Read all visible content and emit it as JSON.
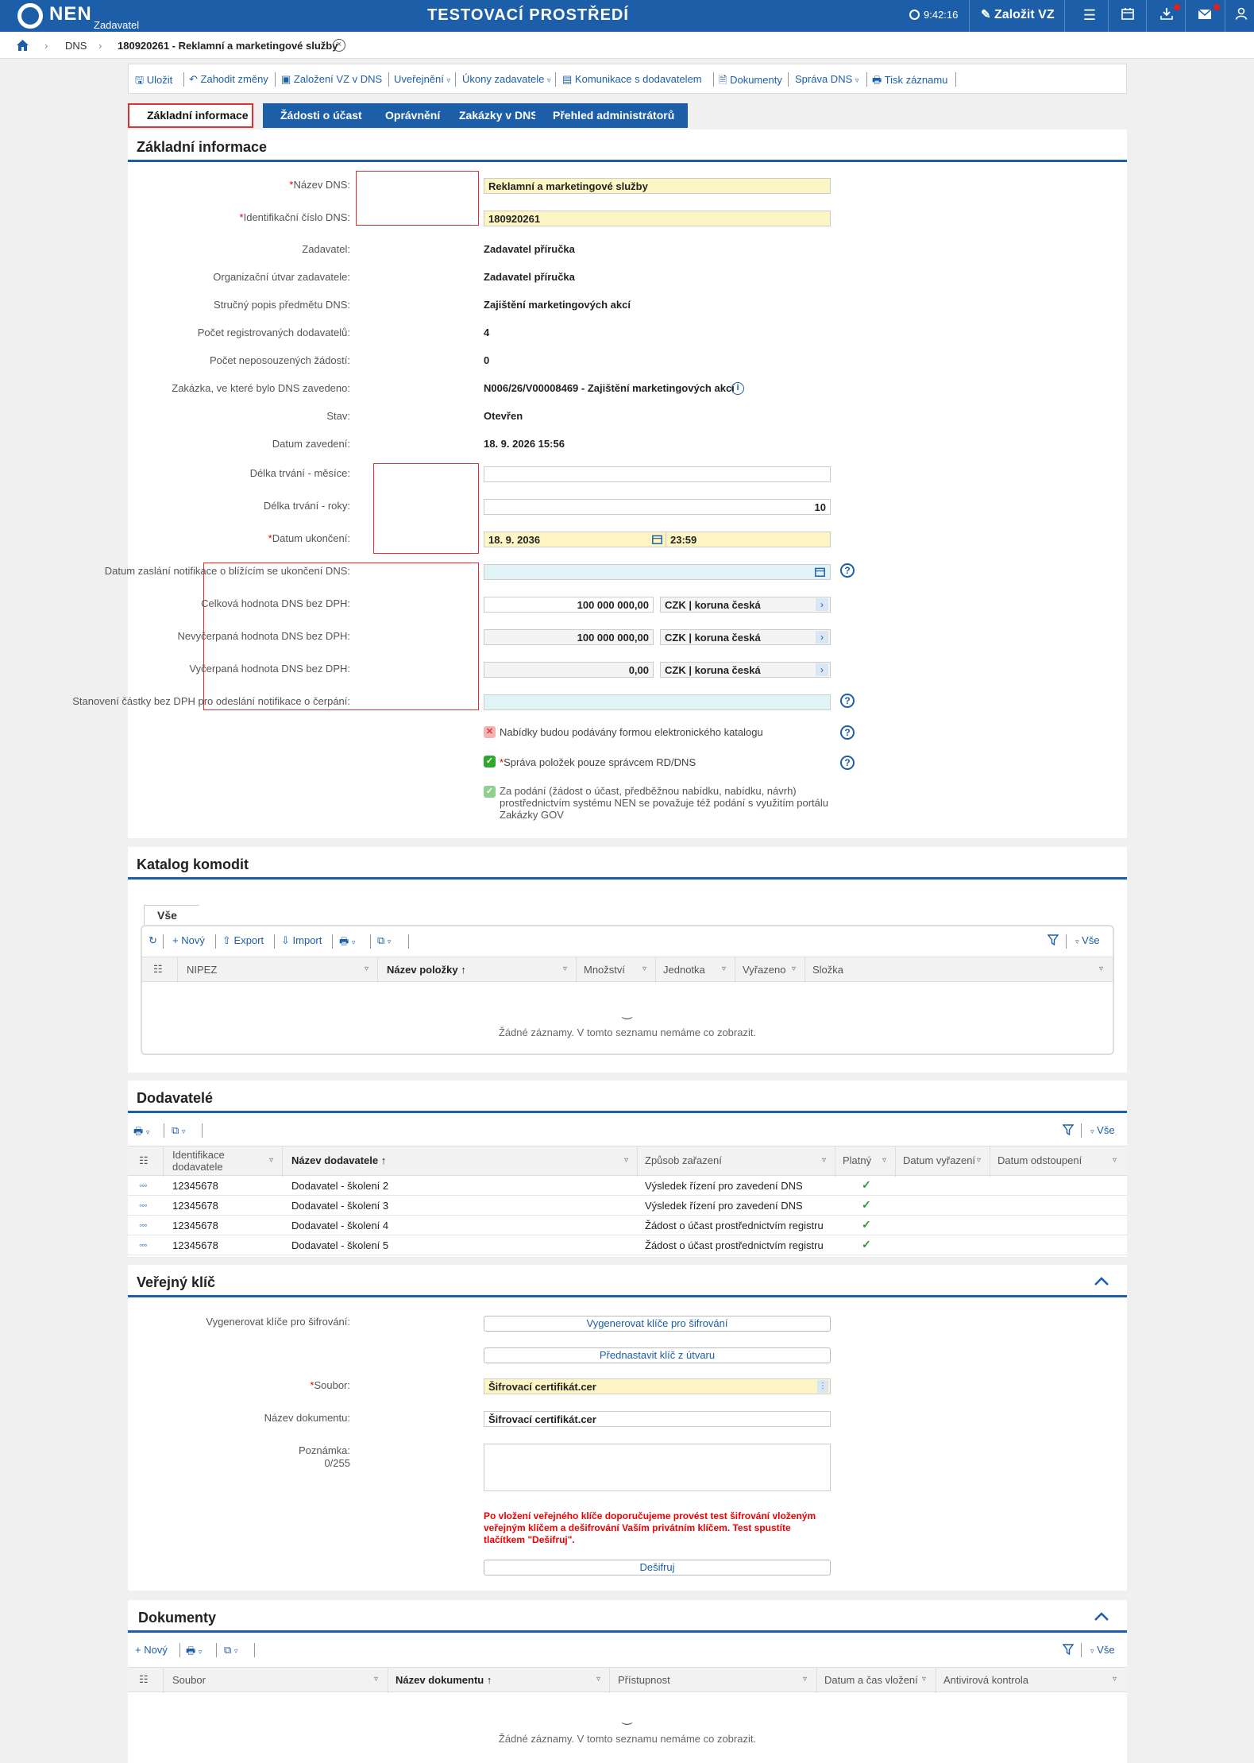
{
  "topbar": {
    "logo": "NEN",
    "logo_sub": "Zadavatel",
    "env_title": "TESTOVACÍ PROSTŘEDÍ",
    "time": "9:42:16",
    "create_label": "Založit VZ"
  },
  "breadcrumb": {
    "item1": "DNS",
    "item2": "180920261 - Reklamní a marketingové služby"
  },
  "toolbar": {
    "save": "Uložit",
    "discard": "Zahodit změny",
    "create_vz": "Založení VZ v DNS",
    "publish": "Uveřejnění",
    "acts": "Úkony zadavatele",
    "comm": "Komunikace s dodavatelem",
    "docs": "Dokumenty",
    "manage": "Správa DNS",
    "print": "Tisk záznamu"
  },
  "tabs": [
    "Základní informace",
    "Žádosti o účast",
    "Oprávnění",
    "Zakázky v DNS",
    "Přehled administrátorů"
  ],
  "basic": {
    "title": "Základní informace",
    "name_label": "Název DNS:",
    "name_value": "Reklamní a marketingové služby",
    "id_label": "Identifikační číslo DNS:",
    "id_value": "180920261",
    "buyer_label": "Zadavatel:",
    "buyer_value": "Zadavatel příručka",
    "org_label": "Organizační útvar zadavatele:",
    "org_value": "Zadavatel příručka",
    "desc_label": "Stručný popis předmětu DNS:",
    "desc_value": "Zajištění marketingových akcí",
    "reg_label": "Počet registrovaných dodavatelů:",
    "reg_value": "4",
    "pending_label": "Počet neposouzených žádostí:",
    "pending_value": "0",
    "tender_label": "Zakázka, ve které bylo DNS zavedeno:",
    "tender_value": "N006/26/V00008469 - Zajištění marketingových akcí",
    "state_label": "Stav:",
    "state_value": "Otevřen",
    "date_label": "Datum zavedení:",
    "date_value": "18. 9. 2026 15:56",
    "months_label": "Délka trvání - měsíce:",
    "months_value": "",
    "years_label": "Délka trvání - roky:",
    "years_value": "10",
    "end_label": "Datum ukončení:",
    "end_date": "18. 9. 2036",
    "end_time": "23:59",
    "notify_label": "Datum zaslání notifikace o blížícím se ukončení DNS:",
    "total_label": "Celková hodnota DNS bez DPH:",
    "total_value": "100 000 000,00",
    "remaining_label": "Nevyčerpaná hodnota DNS bez DPH:",
    "remaining_value": "100 000 000,00",
    "used_label": "Vyčerpaná hodnota DNS bez DPH:",
    "used_value": "0,00",
    "currency": "CZK | koruna česká",
    "amount_label": "Stanovení částky bez DPH pro odeslání notifikace o čerpání:",
    "cb1": "Nabídky budou podávány formou elektronického katalogu",
    "cb2": "Správa položek pouze správcem RD/DNS",
    "cb3": "Za podání (žádost o účast, předběžnou nabídku, nabídku, návrh) prostřednictvím systému NEN se považuje též podání s využitím portálu Zakázky GOV"
  },
  "catalog": {
    "title": "Katalog komodit",
    "subtab": "Vše",
    "new": "Nový",
    "export": "Export",
    "import": "Import",
    "all": "Vše",
    "columns": [
      "NIPEZ",
      "Název položky",
      "Množství",
      "Jednotka",
      "Vyřazeno",
      "Složka"
    ],
    "empty": "Žádné záznamy. V tomto seznamu nemáme co zobrazit."
  },
  "suppliers": {
    "title": "Dodavatelé",
    "all": "Vše",
    "col_id": "Identifikace dodavatele",
    "col_name": "Název dodavatele",
    "col_way": "Způsob zařazení",
    "col_valid": "Platný",
    "col_removed": "Datum vyřazení",
    "col_withdrawn": "Datum odstoupení",
    "rows": [
      {
        "id": "12345678",
        "name": "Dodavatel - školení 2",
        "way": "Výsledek řízení pro zavedení DNS"
      },
      {
        "id": "12345678",
        "name": "Dodavatel - školení 3",
        "way": "Výsledek řízení pro zavedení DNS"
      },
      {
        "id": "12345678",
        "name": "Dodavatel - školení 4",
        "way": "Žádost o účast prostřednictvím registru"
      },
      {
        "id": "12345678",
        "name": "Dodavatel - školení 5",
        "way": "Žádost o účast prostřednictvím registru"
      }
    ]
  },
  "pubkey": {
    "title": "Veřejný klíč",
    "gen_label": "Vygenerovat klíče pro šifrování:",
    "gen_btn": "Vygenerovat klíče pro šifrování",
    "preset_btn": "Přednastavit klíč z útvaru",
    "file_label": "Soubor:",
    "file_value": "Šifrovací certifikát.cer",
    "docname_label": "Název dokumentu:",
    "docname_value": "Šifrovací certifikát.cer",
    "note_label": "Poznámka:",
    "note_count": "0/255",
    "warning": "Po vložení veřejného klíče doporučujeme provést test šifrování vloženým veřejným klíčem a dešifrování Vaším privátním klíčem. Test spustíte tlačítkem \"Dešifruj\".",
    "decrypt_btn": "Dešifruj"
  },
  "documents": {
    "title": "Dokumenty",
    "new": "Nový",
    "all": "Vše",
    "columns": [
      "Soubor",
      "Název dokumentu",
      "Přístupnost",
      "Datum a čas vložení",
      "Antivirová kontrola"
    ],
    "empty": "Žádné záznamy. V tomto seznamu nemáme co zobrazit."
  }
}
